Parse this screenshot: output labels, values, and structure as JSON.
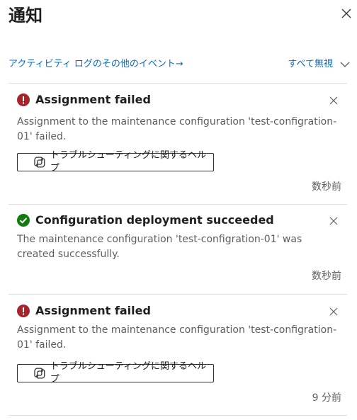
{
  "header": {
    "title": "通知",
    "close_icon": "close-icon"
  },
  "toolbar": {
    "activity_link": "アクティビティ ログのその他のイベント→",
    "dismiss_all": "すべて無視"
  },
  "notifications": [
    {
      "status": "error",
      "status_color": "#a4262c",
      "title": "Assignment failed",
      "description": "Assignment to the maintenance configuration 'test-configration-01' failed.",
      "help_button": "トラブルシューティングに関するヘルプ",
      "time": "数秒前"
    },
    {
      "status": "success",
      "status_color": "#107c10",
      "title": "Configuration deployment succeeded",
      "description": "The maintenance configuration 'test-configration-01' was created successfully.",
      "time": "数秒前"
    },
    {
      "status": "error",
      "status_color": "#a4262c",
      "title": "Assignment failed",
      "description": "Assignment to the maintenance configuration 'test-configration-01' failed.",
      "help_button": "トラブルシューティングに関するヘルプ",
      "time": "9 分前"
    }
  ],
  "colors": {
    "link": "#0f6cbd",
    "error": "#a4262c",
    "success": "#107c10",
    "divider": "#e1dfdd"
  }
}
